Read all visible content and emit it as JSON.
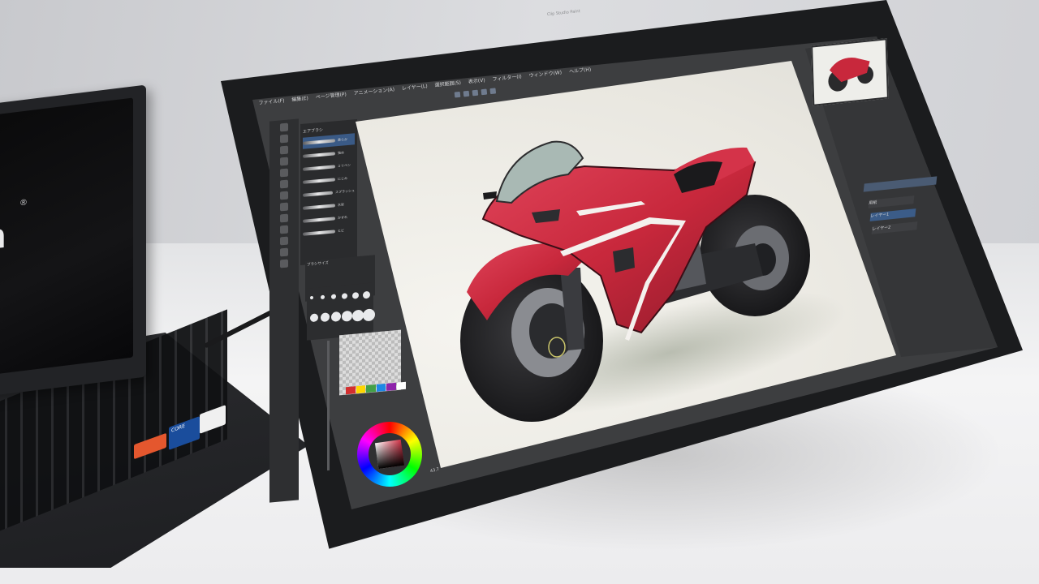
{
  "window": {
    "title": "Clip Studio Paint"
  },
  "menubar": {
    "items": [
      "ファイル(F)",
      "編集(E)",
      "ページ管理(P)",
      "アニメーション(A)",
      "レイヤー(L)",
      "選択範囲(S)",
      "表示(V)",
      "フィルター(I)",
      "ウィンドウ(W)",
      "ヘルプ(H)"
    ]
  },
  "subtool": {
    "title": "エアブラシ",
    "brushes": [
      {
        "label": "柔らか",
        "selected": true
      },
      {
        "label": "強め"
      },
      {
        "label": "ミリペン"
      },
      {
        "label": "にじみ"
      },
      {
        "label": "スプラッシュ"
      },
      {
        "label": "水彩"
      },
      {
        "label": "かすれ"
      },
      {
        "label": "ヒビ"
      }
    ]
  },
  "toolprops": {
    "brushsize_label": "ブラシサイズ"
  },
  "laptop": {
    "logo": "n",
    "reg": "®",
    "sticker_blue": "CORE"
  },
  "layers": {
    "rows": [
      "用紙",
      "レイヤー1",
      "レイヤー2"
    ]
  },
  "colors": {
    "accent": "#3b5c88",
    "moto_red": "#c8283c",
    "swatches": [
      "#d32f2f",
      "#ffd600",
      "#43a047",
      "#1e88e5",
      "#8e24aa",
      "#ffffff"
    ]
  },
  "status": {
    "zoom": "43.7"
  }
}
